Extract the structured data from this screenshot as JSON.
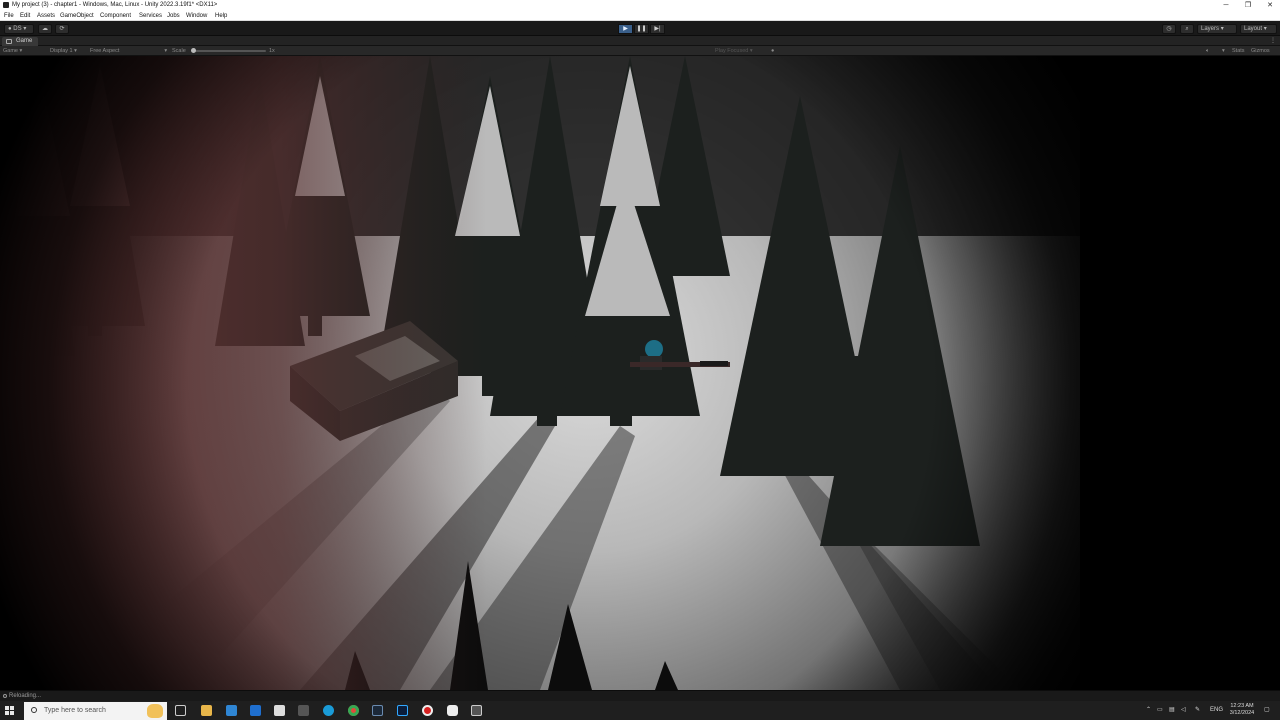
{
  "window": {
    "title": "My project (3) - chapter1 - Windows, Mac, Linux - Unity 2022.3.19f1* <DX11>"
  },
  "menu": [
    "File",
    "Edit",
    "Assets",
    "GameObject",
    "Component",
    "Services",
    "Jobs",
    "Window",
    "Help"
  ],
  "toolbar": {
    "account_label": "DS",
    "layers_label": "Layers",
    "layout_label": "Layout"
  },
  "tab": {
    "label": "Game"
  },
  "gamebar": {
    "mode": "Game",
    "display": "Display 1",
    "aspect": "Free Aspect",
    "scale_label": "Scale",
    "scale_value": "1x",
    "play_focused": "Play Focused",
    "stats": "Stats",
    "gizmos": "Gizmos"
  },
  "status": {
    "text": "Reloading..."
  },
  "taskbar": {
    "search_placeholder": "Type here to search",
    "lang": "ENG",
    "time": "12:23 AM",
    "date": "3/12/2024"
  },
  "colors": {
    "accent_play": "#3a5f8a",
    "editor_bg": "#191919",
    "snow": "#e0e0e0",
    "red_tint": "#6e3a3a"
  }
}
